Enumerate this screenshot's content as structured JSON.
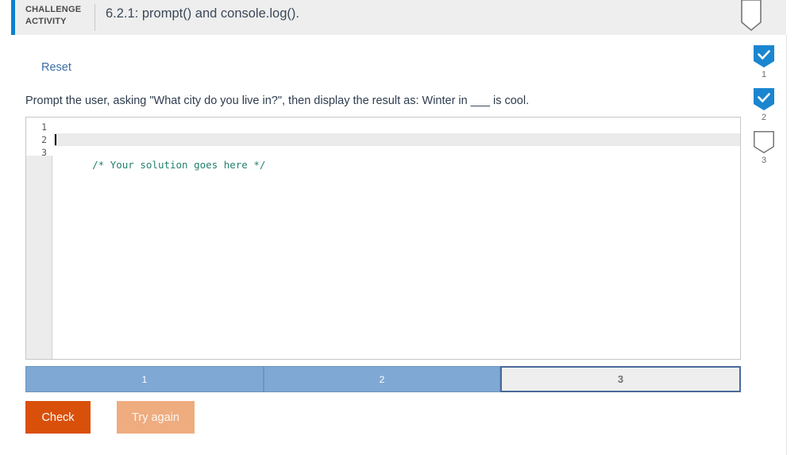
{
  "header": {
    "kicker_line1": "CHALLENGE",
    "kicker_line2": "ACTIVITY",
    "title": "6.2.1: prompt() and console.log().",
    "accent_color": "#0d80d0",
    "background": "#eeeeee",
    "bookmark_icon": "bookmark-outline-icon"
  },
  "rail": {
    "items": [
      {
        "number": "1",
        "state": "complete",
        "icon": "check-bookmark-icon"
      },
      {
        "number": "2",
        "state": "complete",
        "icon": "check-bookmark-icon"
      },
      {
        "number": "3",
        "state": "empty",
        "icon": "bookmark-outline-icon"
      }
    ],
    "complete_color": "#1a86d0"
  },
  "body": {
    "reset_label": "Reset",
    "reset_color": "#3a6ea5",
    "instruction": "Prompt the user, asking \"What city do you live in?\", then display the result as: Winter in ___ is cool."
  },
  "editor": {
    "line_numbers": [
      "1",
      "2",
      "3"
    ],
    "lines": [
      "",
      "/* Your solution goes here */",
      ""
    ],
    "active_line_index": 1,
    "caret_line_index": 1,
    "comment_color": "#23806e",
    "active_line_background": "#ebebeb"
  },
  "progress": {
    "segments": [
      {
        "label": "1",
        "state": "complete"
      },
      {
        "label": "2",
        "state": "complete"
      },
      {
        "label": "3",
        "state": "current"
      }
    ],
    "complete_color": "#7fa8d4",
    "current_border_color": "#4a6a99"
  },
  "buttons": {
    "check_label": "Check",
    "check_color": "#d9500b",
    "try_again_label": "Try again",
    "try_again_color": "#eeac7f"
  }
}
